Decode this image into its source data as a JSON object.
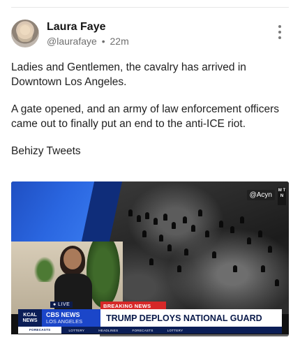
{
  "post": {
    "author_name": "Laura Faye",
    "handle": "@laurafaye",
    "separator": "•",
    "timestamp": "22m",
    "paragraphs": [
      "Ladies and Gentlemen, the cavalry has arrived in Downtown Los Angeles.",
      "A gate opened, and an army of law enforcement officers came out to finally put an end to the anti-ICE riot.",
      "Behizy Tweets"
    ]
  },
  "media": {
    "watermark": "@Acyn",
    "corner_logo": "M T N",
    "live_label": "● LIVE",
    "breaking_label": "BREAKING NEWS",
    "station_label": "KCAL NEWS",
    "network_line1": "CBS NEWS",
    "network_line2": "LOS ANGELES",
    "headline": "TRUMP DEPLOYS NATIONAL GUARD",
    "ticker_items": [
      "FORECASTS",
      "LOTTERY",
      "HEADLINES",
      "FORECASTS",
      "LOTTERY"
    ],
    "video_progress": 0.32
  },
  "colors": {
    "breaking_red": "#d62828",
    "cbs_blue": "#1b46c9",
    "navy": "#0b1e56"
  },
  "icons": {
    "more": "more-vertical-icon",
    "avatar": "avatar"
  }
}
